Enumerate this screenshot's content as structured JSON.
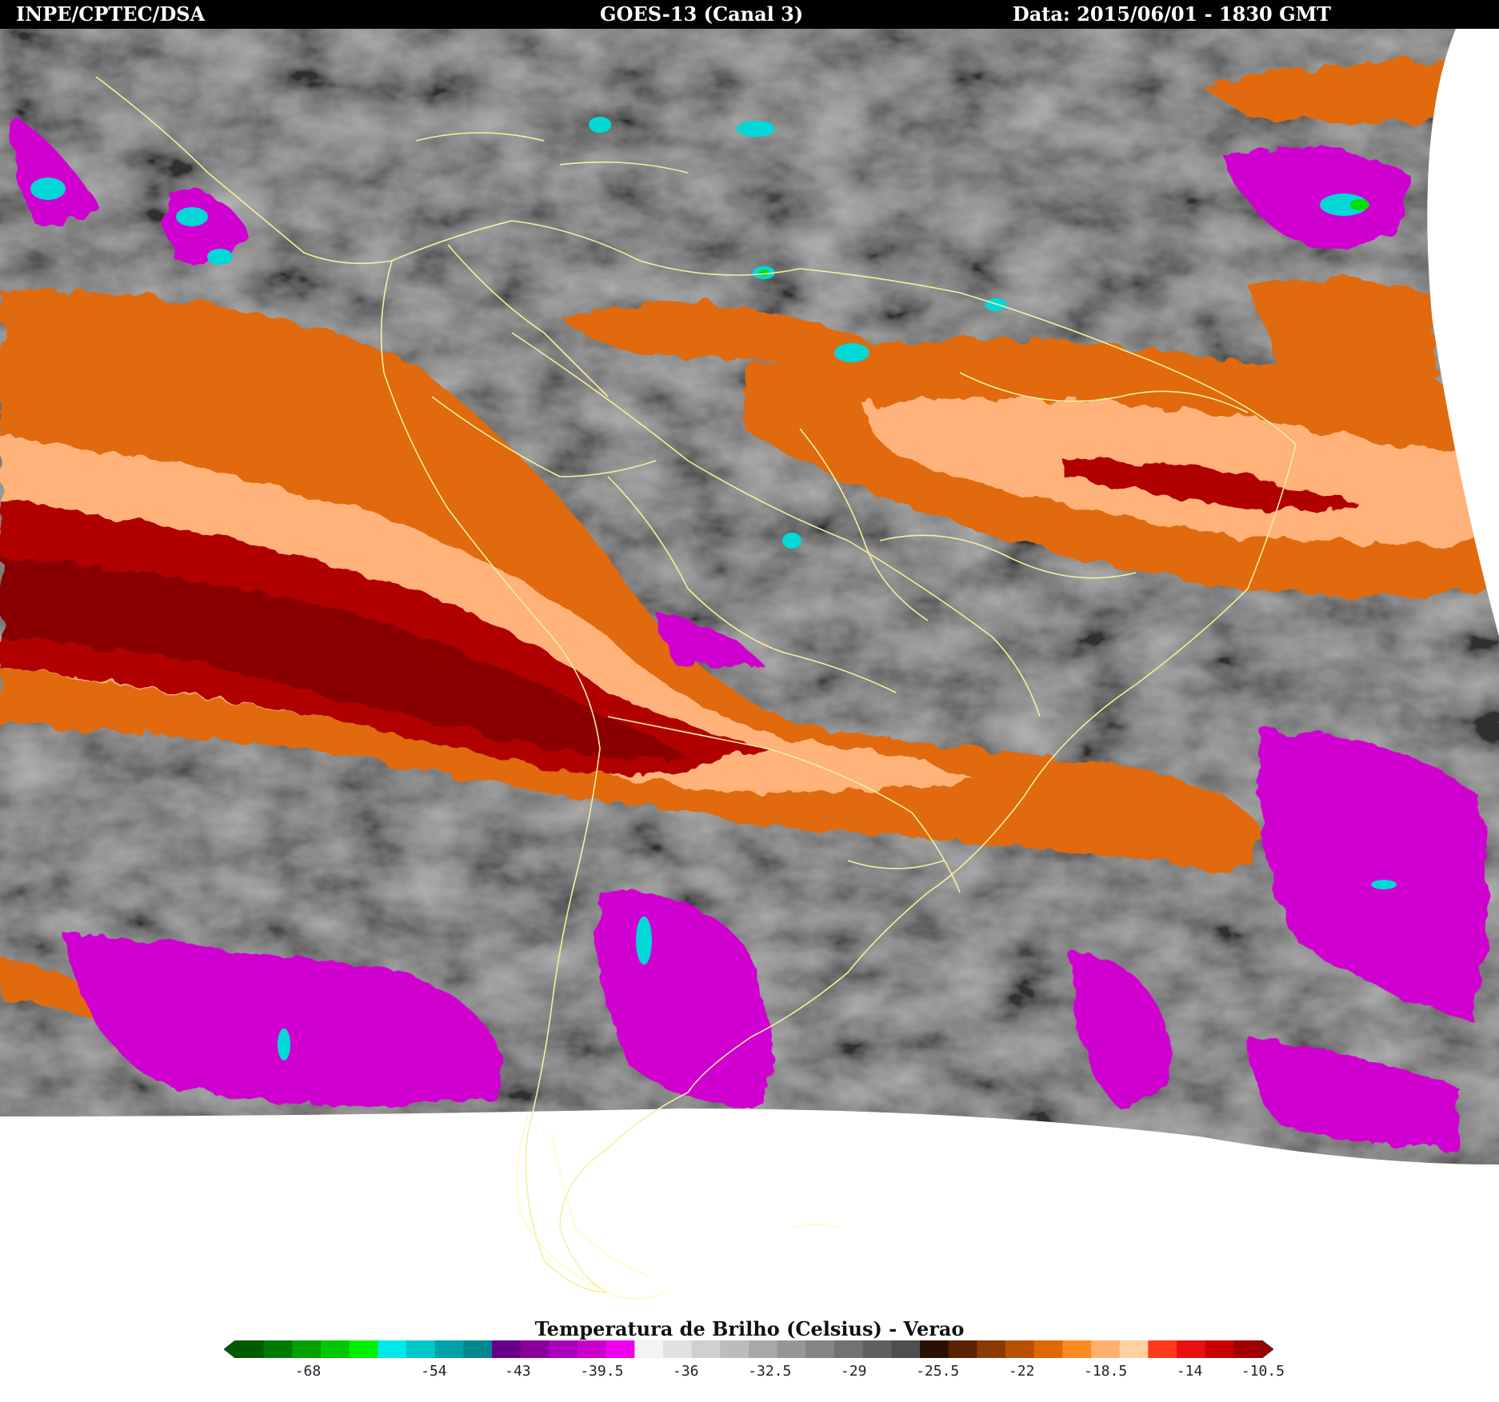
{
  "header": {
    "left": "INPE/CPTEC/DSA",
    "center": "GOES-13 (Canal 3)",
    "right": "Data: 2015/06/01 - 1830 GMT"
  },
  "legend": {
    "title": "Temperatura de Brilho (Celsius) - Verao",
    "ticks": [
      "-68",
      "-54",
      "-43",
      "-39.5",
      "-36",
      "-32.5",
      "-29",
      "-25.5",
      "-22",
      "-18.5",
      "-14",
      "-10.5"
    ],
    "colors": [
      "#005a00",
      "#007a00",
      "#00a000",
      "#00c800",
      "#00f000",
      "#00e8e8",
      "#00c8c8",
      "#00a0a8",
      "#008890",
      "#660088",
      "#880099",
      "#aa00bb",
      "#cc00cc",
      "#ee00ee",
      "#f4f4f4",
      "#e2e2e2",
      "#d0d0d0",
      "#bcbcbc",
      "#a8a8a8",
      "#969696",
      "#848484",
      "#727272",
      "#606060",
      "#4e4e4e",
      "#2a1000",
      "#5a2200",
      "#8a3a00",
      "#b85200",
      "#e06800",
      "#ff8a20",
      "#ffb070",
      "#ffd0a0",
      "#ff3a1a",
      "#e81010",
      "#c80000",
      "#a00000"
    ]
  },
  "map_colors": {
    "background": "#6a6a6a",
    "orange": "#e06a10",
    "peach": "#ffb27a",
    "red": "#b00000",
    "dark_red": "#8a0000",
    "magenta": "#d000d0",
    "cyan": "#00d8d8",
    "green": "#00e000",
    "borders": "#f4f0a0"
  }
}
